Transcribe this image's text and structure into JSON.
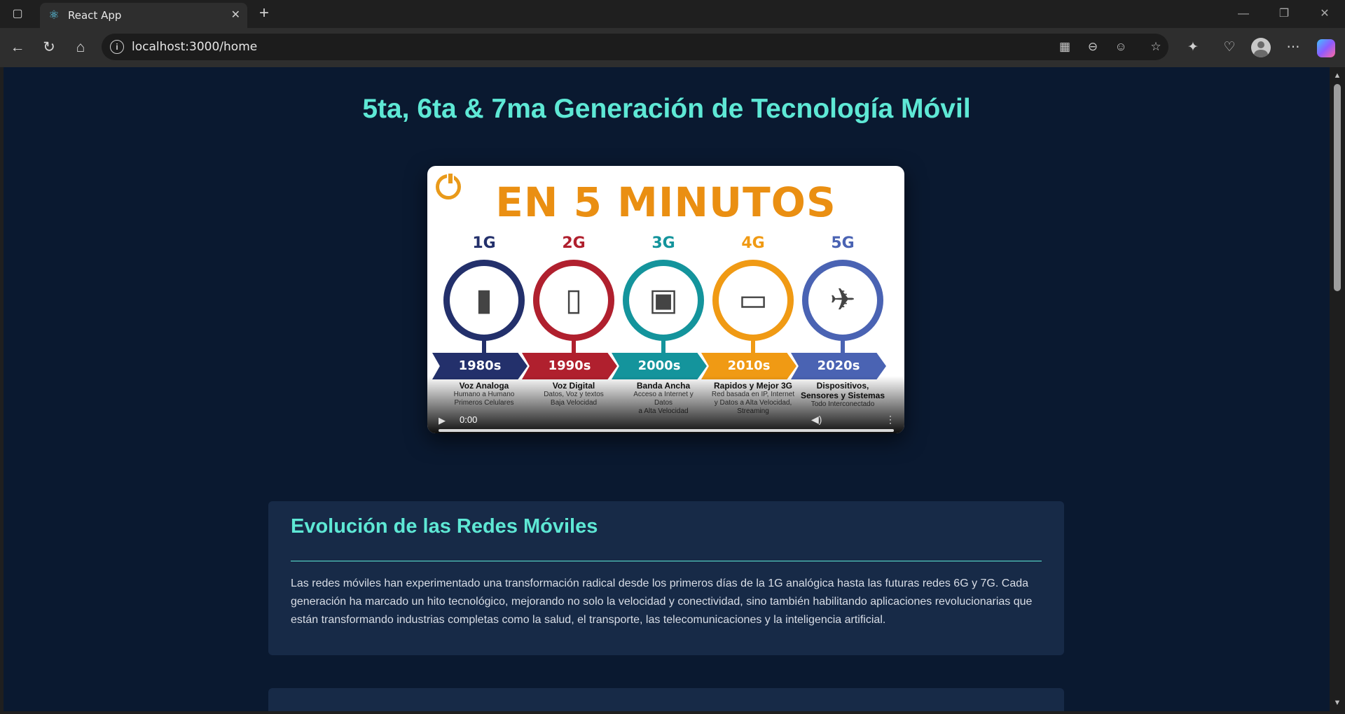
{
  "browser": {
    "tab_title": "React App",
    "url": "localhost:3000/home"
  },
  "page": {
    "title": "5ta, 6ta & 7ma Generación de Tecnología Móvil"
  },
  "video": {
    "banner": "EN 5 MINUTOS",
    "current_time": "0:00",
    "generations": [
      {
        "label": "1G",
        "decade": "1980s",
        "title": "Voz Analoga",
        "subtitle": "Humano a Humano\nPrimeros Celulares",
        "color": "#23306b",
        "device": "phone-brick-icon"
      },
      {
        "label": "2G",
        "decade": "1990s",
        "title": "Voz Digital",
        "subtitle": "Datos, Voz y textos\nBaja Velocidad",
        "color": "#b0202e",
        "device": "phone-candybar-icon"
      },
      {
        "label": "3G",
        "decade": "2000s",
        "title": "Banda Ancha",
        "subtitle": "Acceso a Internet y\nDatos\na Alta Velocidad",
        "color": "#14949c",
        "device": "phone-blackberry-icon"
      },
      {
        "label": "4G",
        "decade": "2010s",
        "title": "Rapidos y Mejor 3G",
        "subtitle": "Red basada en IP, Internet\ny Datos a Alta Velocidad,\nStreaming",
        "color": "#f09a14",
        "device": "laptop-phone-icon"
      },
      {
        "label": "5G",
        "decade": "2020s",
        "title": "Dispositivos, Sensores\ny Sistemas",
        "subtitle": "Todo Interconectado",
        "color": "#4a63b3",
        "device": "drone-icon"
      }
    ]
  },
  "section": {
    "title": "Evolución de las Redes Móviles",
    "body": "Las redes móviles han experimentado una transformación radical desde los primeros días de la 1G analógica hasta las futuras redes 6G y 7G. Cada generación ha marcado un hito tecnológico, mejorando no solo la velocidad y conectividad, sino también habilitando aplicaciones revolucionarias que están transformando industrias completas como la salud, el transporte, las telecomunicaciones y la inteligencia artificial."
  }
}
